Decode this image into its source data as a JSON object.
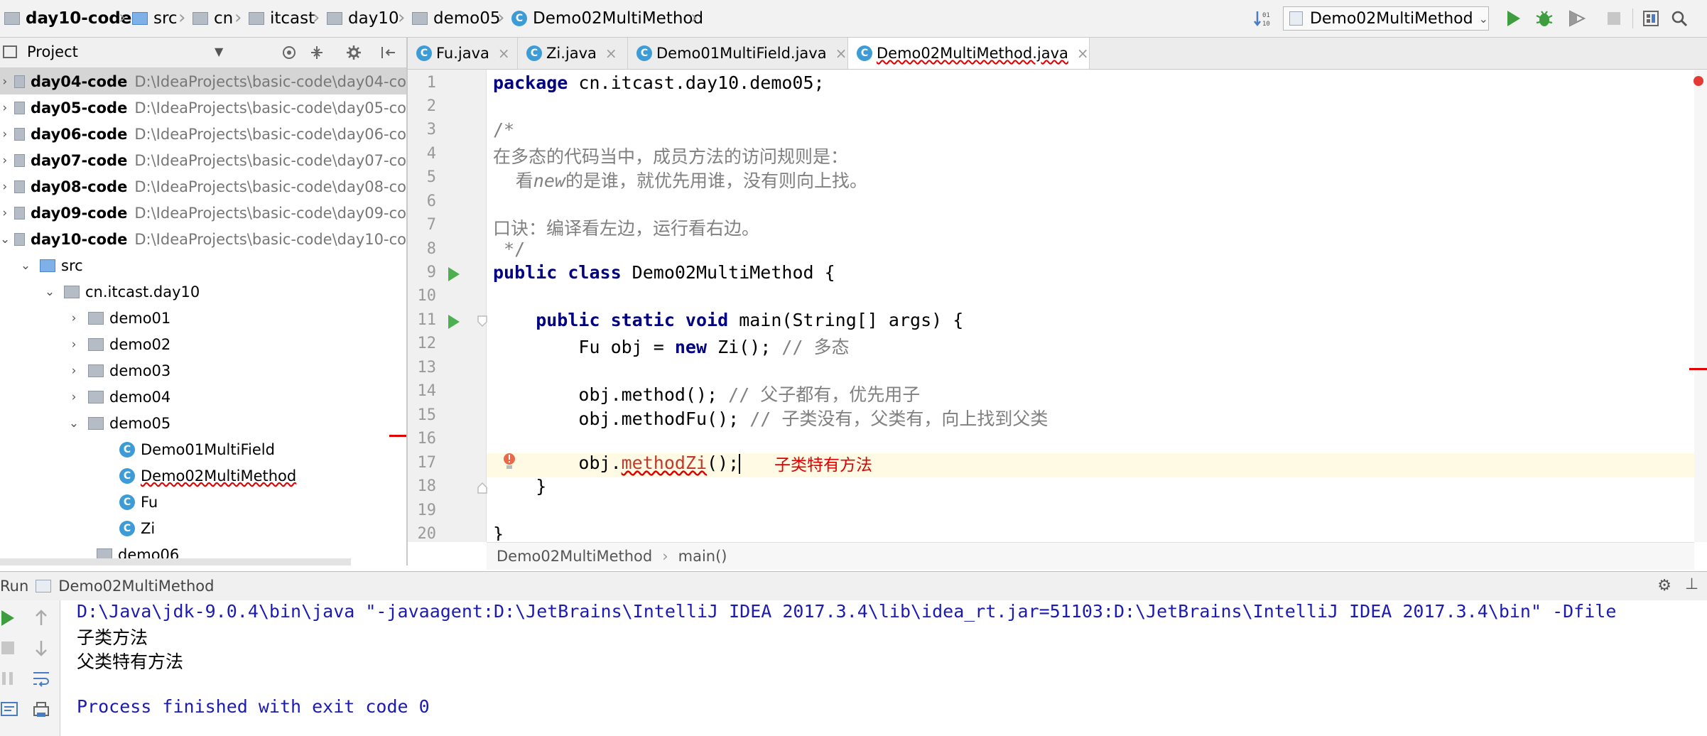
{
  "navbar": {
    "crumbs": [
      "day10-code",
      "src",
      "cn",
      "itcast",
      "day10",
      "demo05",
      "Demo02MultiMethod"
    ],
    "run_config": "Demo02MultiMethod"
  },
  "project": {
    "title": "Project",
    "modules": [
      {
        "name": "day04-code",
        "path": "D:\\IdeaProjects\\basic-code\\day04-co"
      },
      {
        "name": "day05-code",
        "path": "D:\\IdeaProjects\\basic-code\\day05-co"
      },
      {
        "name": "day06-code",
        "path": "D:\\IdeaProjects\\basic-code\\day06-co"
      },
      {
        "name": "day07-code",
        "path": "D:\\IdeaProjects\\basic-code\\day07-co"
      },
      {
        "name": "day08-code",
        "path": "D:\\IdeaProjects\\basic-code\\day08-co"
      },
      {
        "name": "day09-code",
        "path": "D:\\IdeaProjects\\basic-code\\day09-co"
      },
      {
        "name": "day10-code",
        "path": "D:\\IdeaProjects\\basic-code\\day10-co"
      }
    ],
    "src": "src",
    "package": "cn.itcast.day10",
    "folders": [
      "demo01",
      "demo02",
      "demo03",
      "demo04",
      "demo05"
    ],
    "classes": [
      "Demo01MultiField",
      "Demo02MultiMethod",
      "Fu",
      "Zi"
    ],
    "next_folder": "demo06"
  },
  "tabs": [
    "Fu.java",
    "Zi.java",
    "Demo01MultiField.java",
    "Demo02MultiMethod.java"
  ],
  "editor": {
    "line_numbers": [
      "1",
      "2",
      "3",
      "4",
      "5",
      "6",
      "7",
      "8",
      "9",
      "10",
      "11",
      "12",
      "13",
      "14",
      "15",
      "16",
      "17",
      "18",
      "19",
      "20"
    ],
    "l1_kw": "package",
    "l1_rest": " cn.itcast.day10.demo05;",
    "l3": "/*",
    "l4": "在多态的代码当中，成员方法的访问规则是：",
    "l5a": "    看",
    "l5b": "new",
    "l5c": "的是谁，就优先用谁，没有则向上找。",
    "l7": "口诀：编译看左边，运行看右边。",
    "l8": " */",
    "l9_kw": "public class",
    "l9_rest": " Demo02MultiMethod {",
    "l11_kw": "    public static void",
    "l11_rest": " main(String[] args) {",
    "l12a": "        Fu obj = ",
    "l12_kw": "new",
    "l12b": " Zi(); ",
    "l12_cm": "// 多态",
    "l14a": "        obj.method(); ",
    "l14_cm": "// 父子都有，优先用子",
    "l15a": "        obj.methodFu(); ",
    "l15_cm": "// 子类没有，父类有，向上找到父类",
    "l17a": "        obj.",
    "l17_err": "methodZi",
    "l17b": "();",
    "l18": "    }",
    "l20": "}",
    "error_hint": "子类特有方法"
  },
  "editor_breadcrumb": [
    "Demo02MultiMethod",
    "main()"
  ],
  "run": {
    "label": "Run",
    "config": "Demo02MultiMethod",
    "lines": [
      "D:\\Java\\jdk-9.0.4\\bin\\java \"-javaagent:D:\\JetBrains\\IntelliJ IDEA 2017.3.4\\lib\\idea_rt.jar=51103:D:\\JetBrains\\IntelliJ IDEA 2017.3.4\\bin\" -Dfile",
      "子类方法",
      "父类特有方法",
      "",
      "Process finished with exit code 0"
    ]
  },
  "colors": {
    "keyword": "#000080",
    "comment": "#808080",
    "error": "#e00000",
    "run_green": "#4caf50"
  }
}
